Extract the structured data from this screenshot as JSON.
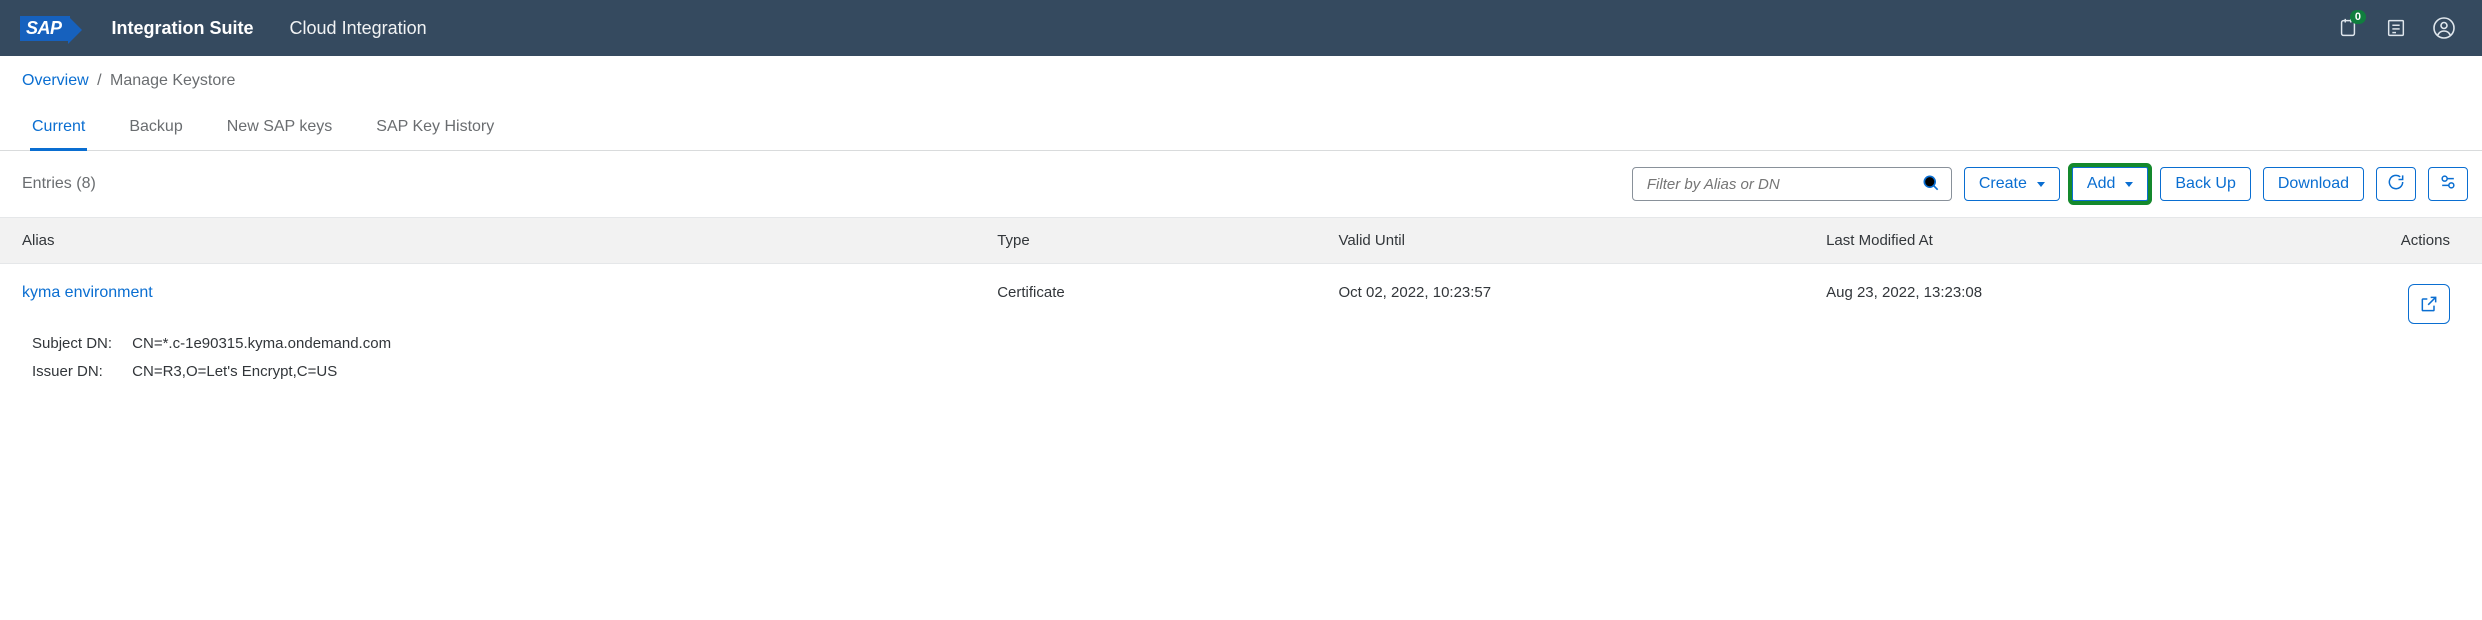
{
  "shellbar": {
    "logo_text": "SAP",
    "product": "Integration Suite",
    "subtitle": "Cloud Integration",
    "notification_badge": "0"
  },
  "breadcrumb": {
    "root": "Overview",
    "current": "Manage Keystore"
  },
  "tabs": [
    {
      "label": "Current",
      "selected": true
    },
    {
      "label": "Backup",
      "selected": false
    },
    {
      "label": "New SAP keys",
      "selected": false
    },
    {
      "label": "SAP Key History",
      "selected": false
    }
  ],
  "toolbar": {
    "entries_label": "Entries (8)",
    "search_placeholder": "Filter by Alias or DN",
    "create_label": "Create",
    "add_label": "Add",
    "backup_label": "Back Up",
    "download_label": "Download"
  },
  "table": {
    "columns": {
      "alias": "Alias",
      "type": "Type",
      "valid_until": "Valid Until",
      "last_modified": "Last Modified At",
      "actions": "Actions"
    },
    "rows": [
      {
        "alias": "kyma environment",
        "type": "Certificate",
        "valid_until": "Oct 02, 2022, 10:23:57",
        "last_modified": "Aug 23, 2022, 13:23:08",
        "subject_dn_label": "Subject DN:",
        "subject_dn": "CN=*.c-1e90315.kyma.ondemand.com",
        "issuer_dn_label": "Issuer DN:",
        "issuer_dn": "CN=R3,O=Let's Encrypt,C=US"
      }
    ]
  }
}
